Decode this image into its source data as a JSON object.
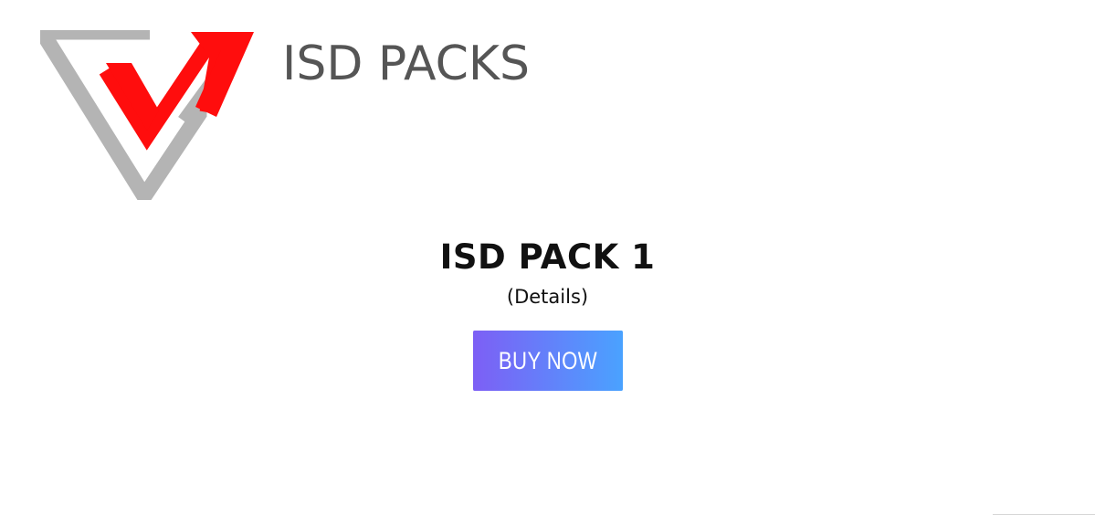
{
  "header": {
    "logo_icon": "isd-v-logo-icon",
    "title": "ISD PACKS"
  },
  "product": {
    "name": "ISD PACK 1",
    "details": "(Details)",
    "buy_label": "BUY NOW"
  },
  "colors": {
    "logo_gray": "#b4b4b4",
    "logo_red": "#ff0d0d",
    "title_gray": "#555555",
    "button_gradient_start": "#7d5ff5",
    "button_gradient_end": "#4aa2ff"
  }
}
